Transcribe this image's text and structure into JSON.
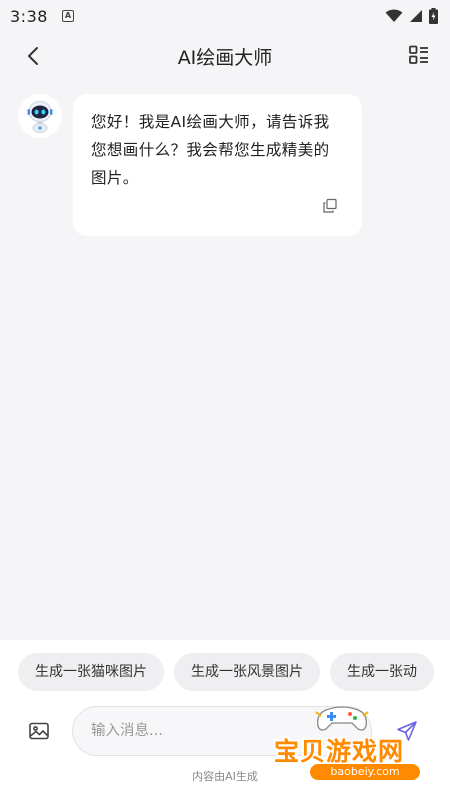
{
  "status_bar": {
    "time": "3:38",
    "notification_letter": "A"
  },
  "header": {
    "title": "AI绘画大师"
  },
  "chat": {
    "messages": [
      {
        "role": "assistant",
        "text": "您好！我是AI绘画大师，请告诉我您想画什么？我会帮您生成精美的图片。"
      }
    ]
  },
  "suggestions": [
    "生成一张猫咪图片",
    "生成一张风景图片",
    "生成一张动"
  ],
  "composer": {
    "placeholder": "输入消息..."
  },
  "footer": {
    "disclaimer": "内容由AI生成"
  },
  "watermark": {
    "title": "宝贝游戏网",
    "url": "baobeiy.com"
  },
  "colors": {
    "accent": "#6b63e8",
    "background": "#f5f5f7",
    "watermark": "#ff8a00"
  },
  "icons": {
    "back": "chevron-left-icon",
    "menu": "list-menu-icon",
    "copy": "copy-icon",
    "image": "image-icon",
    "send": "send-icon"
  }
}
